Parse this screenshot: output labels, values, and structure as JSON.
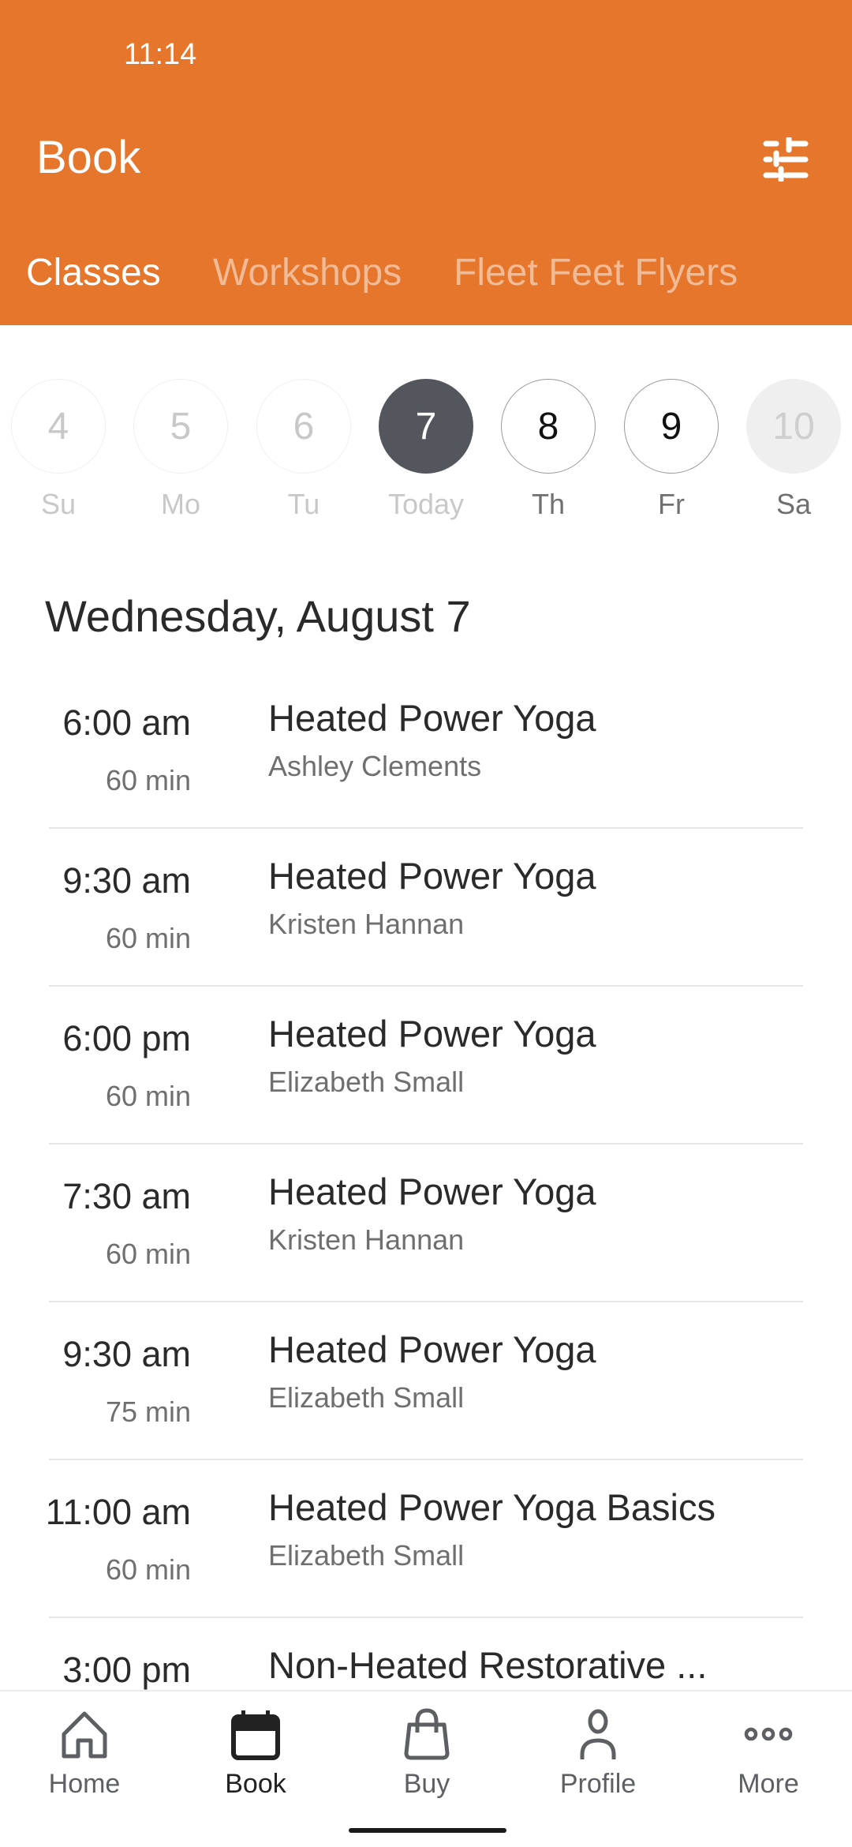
{
  "status_bar": {
    "time": "11:14"
  },
  "header": {
    "title": "Book",
    "filter_icon": "sliders-icon",
    "tabs": [
      {
        "label": "Classes",
        "active": true
      },
      {
        "label": "Workshops",
        "active": false
      },
      {
        "label": "Fleet Feet Flyers",
        "active": false
      }
    ]
  },
  "colors": {
    "brand": "#e5762b",
    "selected_day": "#53565d"
  },
  "date_strip": [
    {
      "num": "4",
      "label": "Su",
      "state": "past"
    },
    {
      "num": "5",
      "label": "Mo",
      "state": "past"
    },
    {
      "num": "6",
      "label": "Tu",
      "state": "past"
    },
    {
      "num": "7",
      "label": "Today",
      "state": "selected"
    },
    {
      "num": "8",
      "label": "Th",
      "state": "future"
    },
    {
      "num": "9",
      "label": "Fr",
      "state": "future"
    },
    {
      "num": "10",
      "label": "Sa",
      "state": "closed"
    }
  ],
  "date_heading": "Wednesday, August 7",
  "classes": [
    {
      "time": "6:00 am",
      "duration": "60 min",
      "name": "Heated Power Yoga",
      "instructor": "Ashley Clements"
    },
    {
      "time": "9:30 am",
      "duration": "60 min",
      "name": "Heated Power Yoga",
      "instructor": "Kristen Hannan"
    },
    {
      "time": "6:00 pm",
      "duration": "60 min",
      "name": "Heated Power Yoga",
      "instructor": "Elizabeth Small"
    },
    {
      "time": "7:30 am",
      "duration": "60 min",
      "name": "Heated Power Yoga",
      "instructor": "Kristen Hannan"
    },
    {
      "time": "9:30 am",
      "duration": "75 min",
      "name": "Heated Power Yoga",
      "instructor": "Elizabeth Small"
    },
    {
      "time": "11:00 am",
      "duration": "60 min",
      "name": "Heated Power Yoga Basics",
      "instructor": "Elizabeth Small"
    },
    {
      "time": "3:00 pm",
      "duration": "",
      "name": "Non-Heated Restorative ...",
      "instructor": ""
    }
  ],
  "bottom_nav": [
    {
      "label": "Home",
      "icon": "home-icon",
      "active": false
    },
    {
      "label": "Book",
      "icon": "calendar-icon",
      "active": true
    },
    {
      "label": "Buy",
      "icon": "shopping-bag-icon",
      "active": false
    },
    {
      "label": "Profile",
      "icon": "person-icon",
      "active": false
    },
    {
      "label": "More",
      "icon": "more-dots-icon",
      "active": false
    }
  ]
}
